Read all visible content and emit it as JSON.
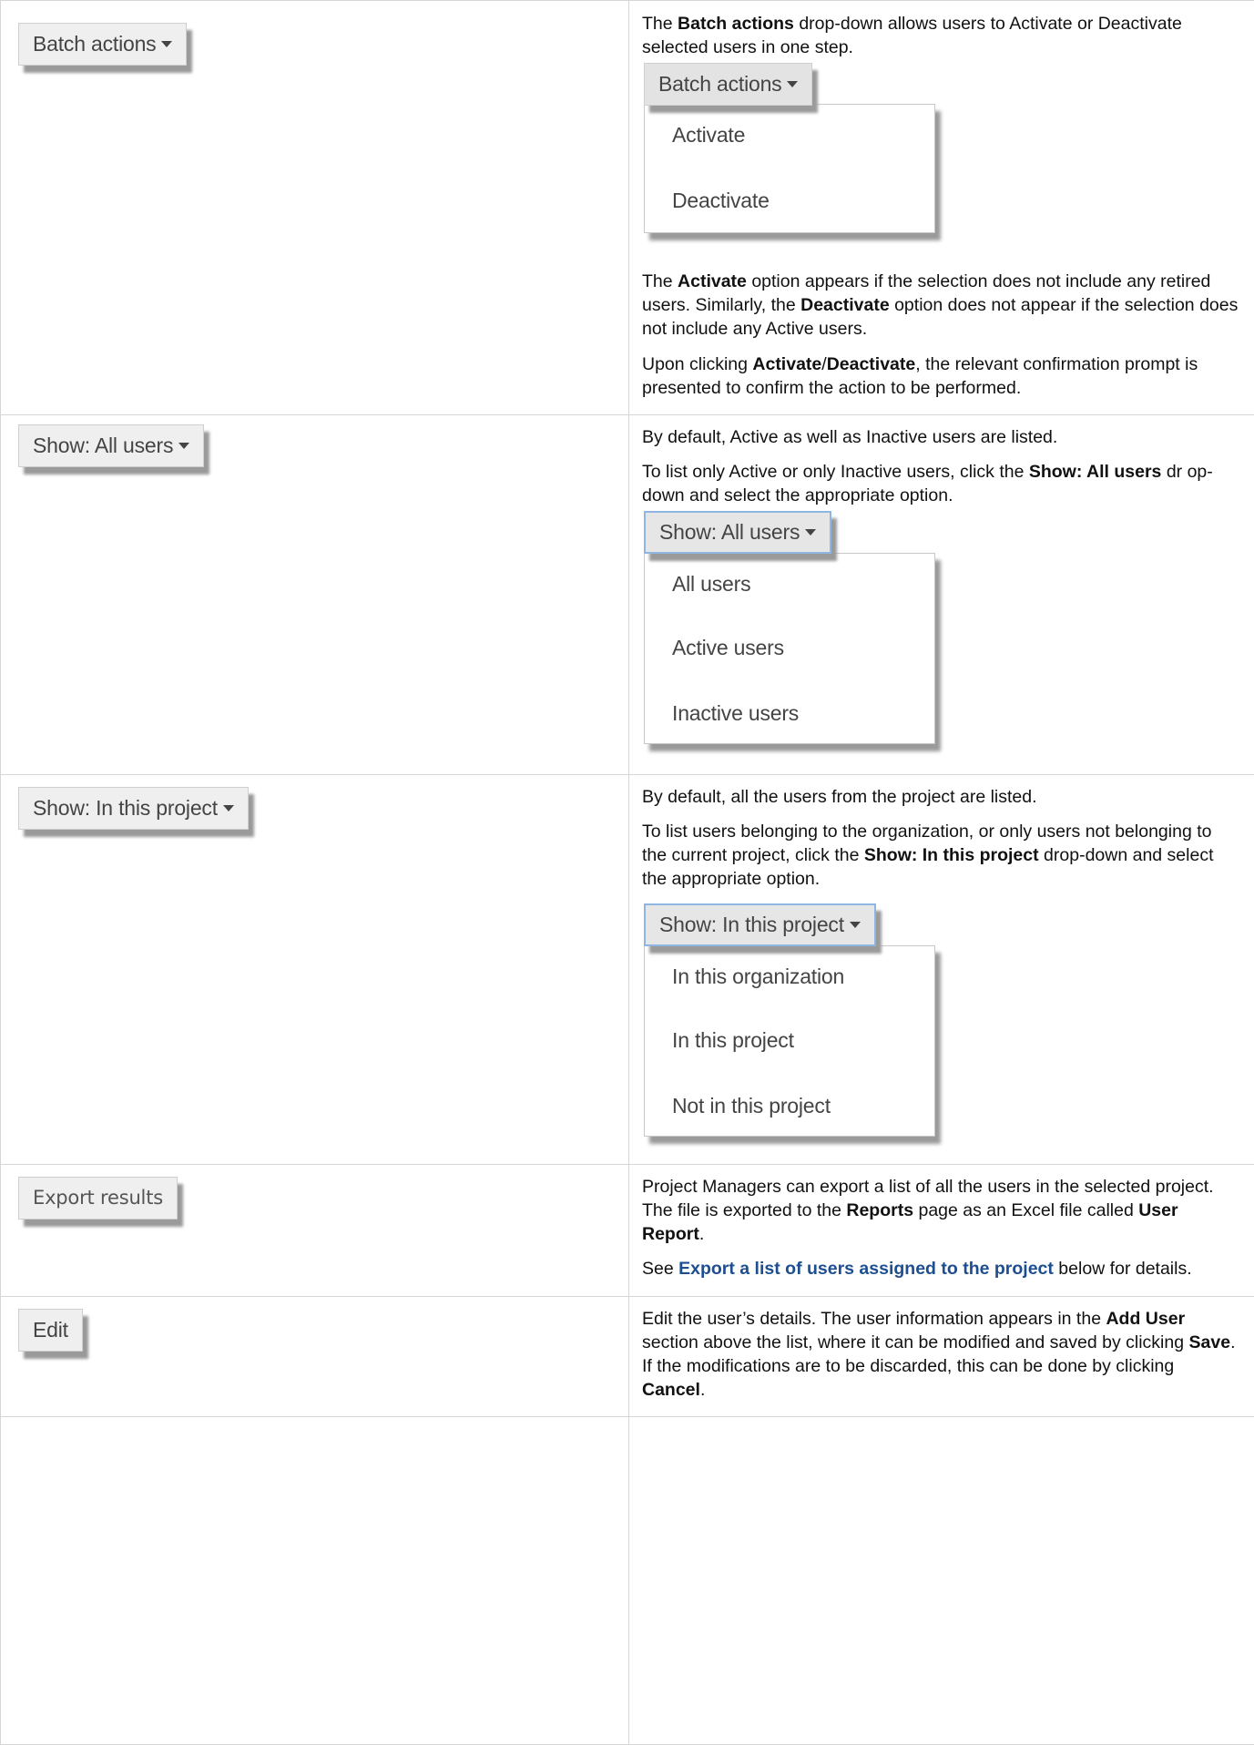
{
  "rows": [
    {
      "button_label": "Batch actions",
      "para1": [
        {
          "t": "The ",
          "b": false
        },
        {
          "t": "Batch actions",
          "b": true
        },
        {
          "t": " drop-down allows users to Activate or Deactivate selected users in one step.",
          "b": false
        }
      ],
      "mock_button_label": "Batch actions",
      "menu_items": [
        "Activate",
        "Deactivate"
      ],
      "para2": [
        {
          "t": "The ",
          "b": false
        },
        {
          "t": "Activate",
          "b": true
        },
        {
          "t": " option appears if the selection does not include any retired users. Similarly, the ",
          "b": false
        },
        {
          "t": "Deactivate",
          "b": true
        },
        {
          "t": " option does not appear if the selection does not include any Active users.",
          "b": false
        }
      ],
      "para3": [
        {
          "t": "Upon clicking ",
          "b": false
        },
        {
          "t": "Activate",
          "b": true
        },
        {
          "t": "/",
          "b": false
        },
        {
          "t": "Deactivate",
          "b": true
        },
        {
          "t": ", the relevant confirmation prompt is presented to confirm the action to be performed.",
          "b": false
        }
      ]
    },
    {
      "button_label": "Show: All users",
      "para1": [
        {
          "t": "By default, Active as well as Inactive users are listed.",
          "b": false
        }
      ],
      "para2": [
        {
          "t": "To list only Active or only Inactive users, click the ",
          "b": false
        },
        {
          "t": "Show: All users",
          "b": true
        },
        {
          "t": " dr op-down and select the appropriate option.",
          "b": false
        }
      ],
      "mock_button_label": "Show: All users",
      "menu_items": [
        "All users",
        "Active users",
        "Inactive users"
      ]
    },
    {
      "button_label": "Show: In this project",
      "para1": [
        {
          "t": "By default, all the users from the project are listed.",
          "b": false
        }
      ],
      "para2": [
        {
          "t": "To list users belonging to the organization, or only users not belonging to the current project, click the ",
          "b": false
        },
        {
          "t": "Show: In this project",
          "b": true
        },
        {
          "t": " drop-down and select the appropriate option.",
          "b": false
        }
      ],
      "mock_button_label": "Show: In this project",
      "menu_items": [
        "In this organization",
        "In this project",
        "Not in this project"
      ]
    },
    {
      "button_label": "Export results",
      "para1": [
        {
          "t": "Project Managers can export a list of all the users in the selected project. The file is exported to the ",
          "b": false
        },
        {
          "t": "Reports",
          "b": true
        },
        {
          "t": " page as an Excel file called ",
          "b": false
        },
        {
          "t": "User Report",
          "b": true
        },
        {
          "t": ".",
          "b": false
        }
      ],
      "para2_prefix": "See ",
      "para2_link": "Export a list of users assigned to the project",
      "para2_suffix": " below for details."
    },
    {
      "button_label": "Edit",
      "para1": [
        {
          "t": "Edit the user’s details. The user information appears in the ",
          "b": false
        },
        {
          "t": "Add User",
          "b": true
        },
        {
          "t": " section above the list, where it can be modified and saved by clicking ",
          "b": false
        },
        {
          "t": "Save",
          "b": true
        },
        {
          "t": ". If the modifications are to be discarded, this can be done by clicking ",
          "b": false
        },
        {
          "t": "Cancel",
          "b": true
        },
        {
          "t": ".",
          "b": false
        }
      ]
    }
  ],
  "colors": {
    "link": "#1d4e8f",
    "border": "#d6d6d6",
    "button_bg": "#efefef",
    "focus_border": "#8fb6e3"
  }
}
